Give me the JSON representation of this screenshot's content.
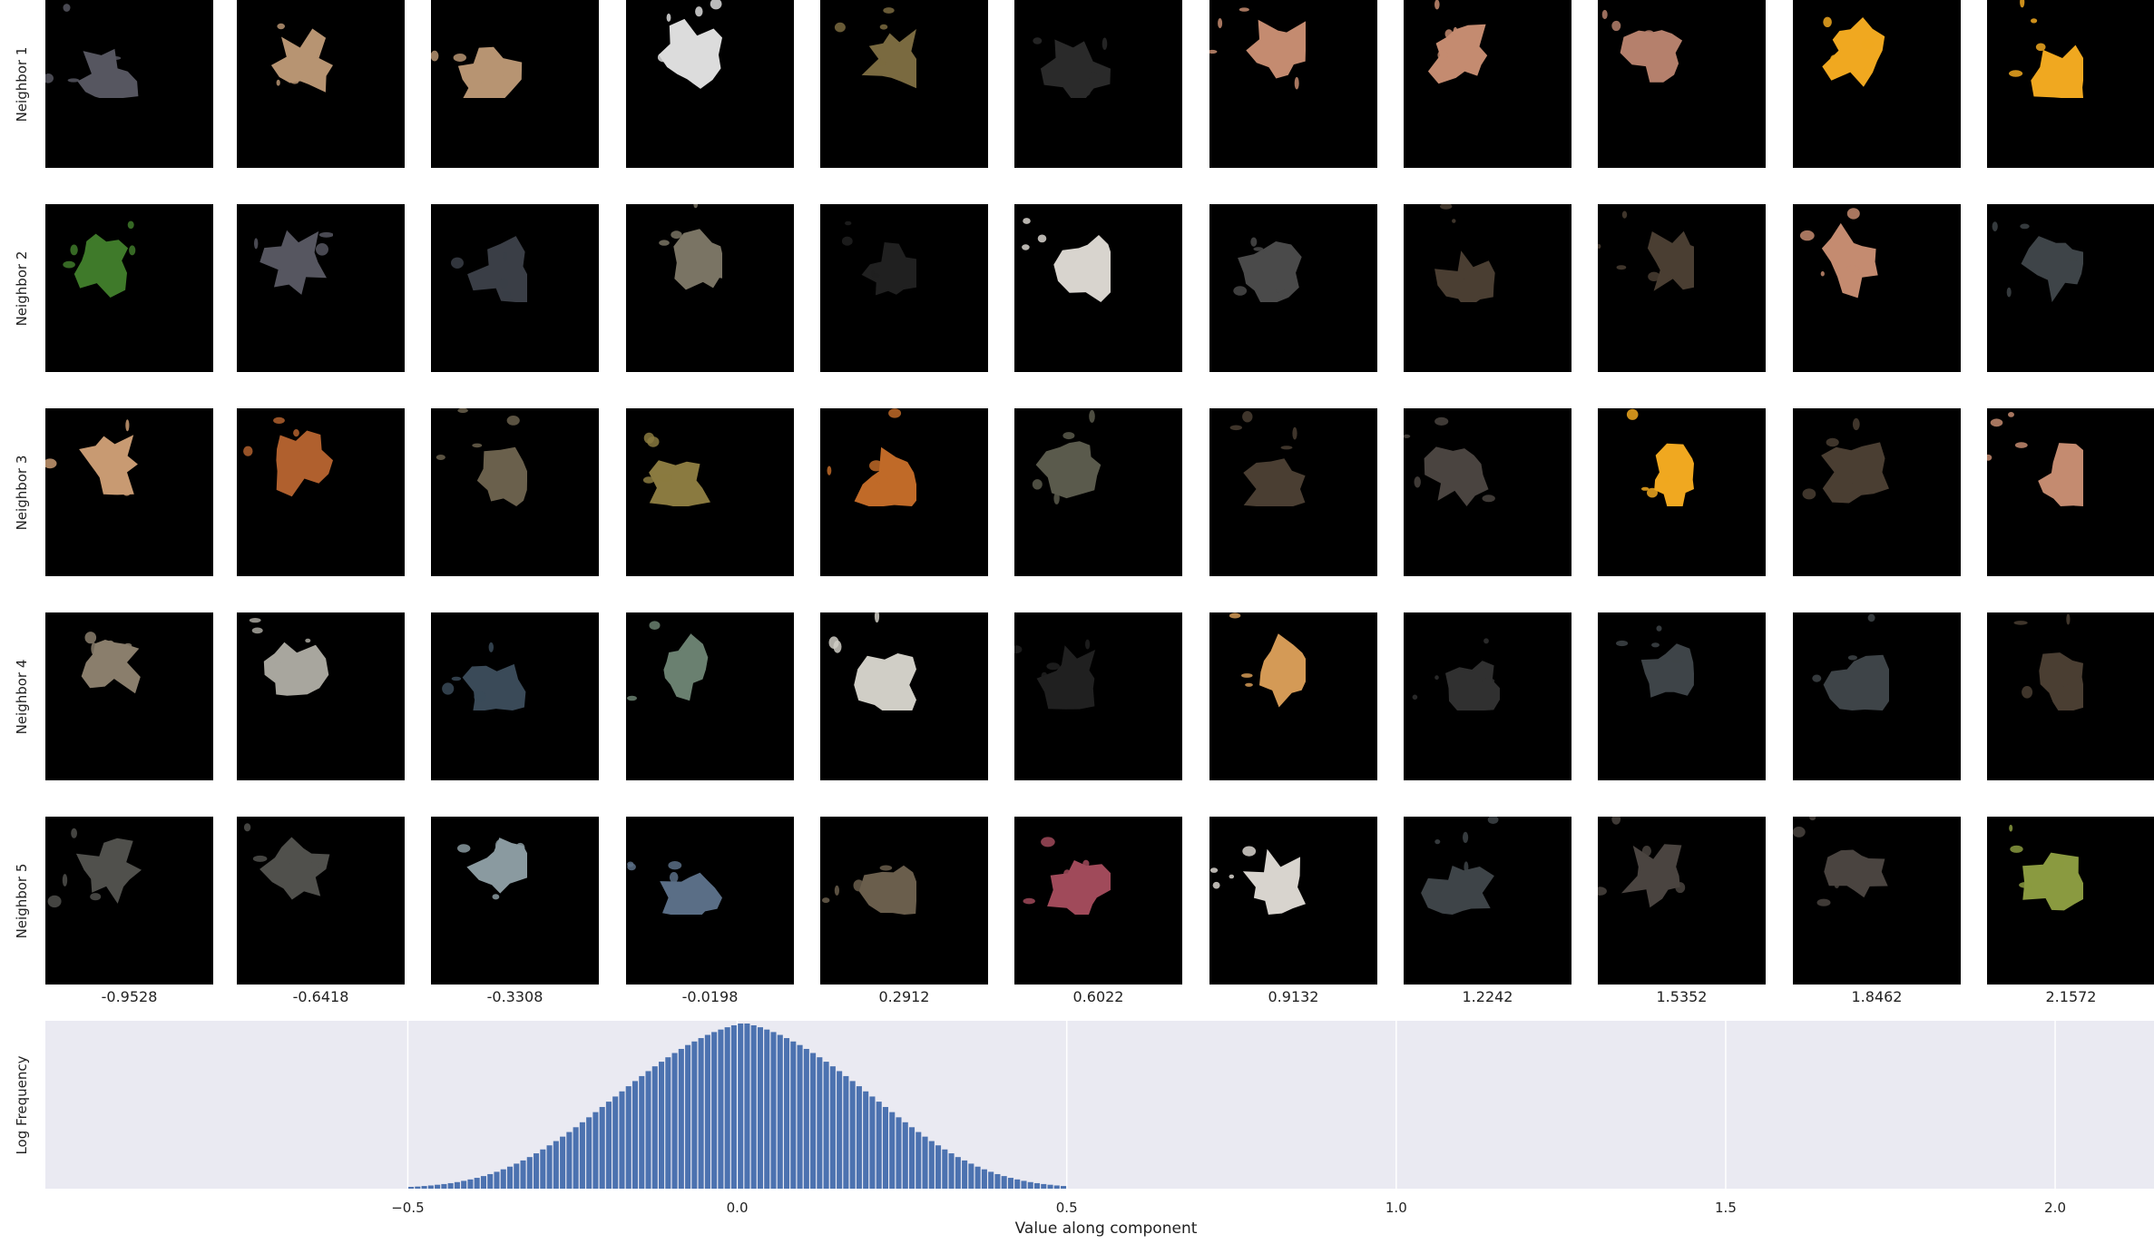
{
  "rows": [
    "Neighbor 1",
    "Neighbor 2",
    "Neighbor 3",
    "Neighbor 4",
    "Neighbor 5"
  ],
  "columns": [
    "-0.9528",
    "-0.6418",
    "-0.3308",
    "-0.0198",
    "0.2912",
    "0.6022",
    "0.9132",
    "1.2242",
    "1.5352",
    "1.8462",
    "2.1572"
  ],
  "tiles": [
    [
      "#565660",
      "#b79472",
      "#b79472",
      "#dcdcdc",
      "#7a6a40",
      "#2a2a2a",
      "#c48b70",
      "#c48b70",
      "#b5806c",
      "#f0a820",
      "#f0a820"
    ],
    [
      "#3f7a2a",
      "#565660",
      "#3a3e46",
      "#7a7464",
      "#202020",
      "#d8d4ce",
      "#4a4a4a",
      "#4a3e32",
      "#4a3e32",
      "#c48b70",
      "#3e4448"
    ],
    [
      "#c89a72",
      "#b0602e",
      "#6a604c",
      "#8a7a40",
      "#c06a28",
      "#5a5a4c",
      "#4a3e32",
      "#4a4440",
      "#f0a820",
      "#4a3e32",
      "#c48b70"
    ],
    [
      "#8a7e6c",
      "#a8a69e",
      "#3a4a58",
      "#6a8070",
      "#d0cec6",
      "#202020",
      "#d49a56",
      "#303030",
      "#3e4448",
      "#3e4448",
      "#4a3e32"
    ],
    [
      "#50504c",
      "#50504c",
      "#8a9aa0",
      "#5a6e86",
      "#6a5e4c",
      "#a04a5a",
      "#d8d4ce",
      "#3e4448",
      "#4a4440",
      "#4a4440",
      "#8a9a40"
    ]
  ],
  "chart_data": {
    "type": "bar",
    "xlabel": "Value along component",
    "ylabel": "Log Frequency",
    "xlim": [
      -1.05,
      2.15
    ],
    "xticks": [
      "−0.5",
      "0.0",
      "0.5",
      "1.0",
      "1.5",
      "2.0"
    ],
    "xtick_values": [
      -0.5,
      0.0,
      0.5,
      1.0,
      1.5,
      2.0
    ],
    "grid": true,
    "bar_color": "#4c72b0",
    "background": "#eaeaf2",
    "bin_width": 0.01,
    "x": [
      -0.5,
      -0.49,
      -0.48,
      -0.47,
      -0.46,
      -0.45,
      -0.44,
      -0.43,
      -0.42,
      -0.41,
      -0.4,
      -0.39,
      -0.38,
      -0.37,
      -0.36,
      -0.35,
      -0.34,
      -0.33,
      -0.32,
      -0.31,
      -0.3,
      -0.29,
      -0.28,
      -0.27,
      -0.26,
      -0.25,
      -0.24,
      -0.23,
      -0.22,
      -0.21,
      -0.2,
      -0.19,
      -0.18,
      -0.17,
      -0.16,
      -0.15,
      -0.14,
      -0.13,
      -0.12,
      -0.11,
      -0.1,
      -0.09,
      -0.08,
      -0.07,
      -0.06,
      -0.05,
      -0.04,
      -0.03,
      -0.02,
      -0.01,
      0.0,
      0.01,
      0.02,
      0.03,
      0.04,
      0.05,
      0.06,
      0.07,
      0.08,
      0.09,
      0.1,
      0.11,
      0.12,
      0.13,
      0.14,
      0.15,
      0.16,
      0.17,
      0.18,
      0.19,
      0.2,
      0.21,
      0.22,
      0.23,
      0.24,
      0.25,
      0.26,
      0.27,
      0.28,
      0.29,
      0.3,
      0.31,
      0.32,
      0.33,
      0.34,
      0.35,
      0.36,
      0.37,
      0.38,
      0.39,
      0.4,
      0.41,
      0.42,
      0.43,
      0.44,
      0.45,
      0.46,
      0.47,
      0.48,
      0.49
    ],
    "values": [
      0.01,
      0.012,
      0.015,
      0.018,
      0.022,
      0.026,
      0.031,
      0.037,
      0.044,
      0.052,
      0.061,
      0.071,
      0.082,
      0.095,
      0.109,
      0.124,
      0.141,
      0.159,
      0.178,
      0.199,
      0.221,
      0.244,
      0.268,
      0.293,
      0.319,
      0.346,
      0.374,
      0.402,
      0.431,
      0.46,
      0.49,
      0.519,
      0.548,
      0.577,
      0.606,
      0.634,
      0.662,
      0.689,
      0.715,
      0.74,
      0.764,
      0.787,
      0.809,
      0.829,
      0.848,
      0.866,
      0.882,
      0.896,
      0.909,
      0.92,
      0.93,
      0.93,
      0.92,
      0.909,
      0.896,
      0.882,
      0.866,
      0.848,
      0.829,
      0.809,
      0.787,
      0.764,
      0.74,
      0.715,
      0.689,
      0.662,
      0.634,
      0.606,
      0.577,
      0.548,
      0.519,
      0.49,
      0.46,
      0.431,
      0.402,
      0.374,
      0.346,
      0.319,
      0.293,
      0.268,
      0.244,
      0.221,
      0.199,
      0.178,
      0.159,
      0.141,
      0.124,
      0.109,
      0.095,
      0.082,
      0.071,
      0.061,
      0.052,
      0.044,
      0.037,
      0.031,
      0.026,
      0.022,
      0.018,
      0.015
    ]
  }
}
